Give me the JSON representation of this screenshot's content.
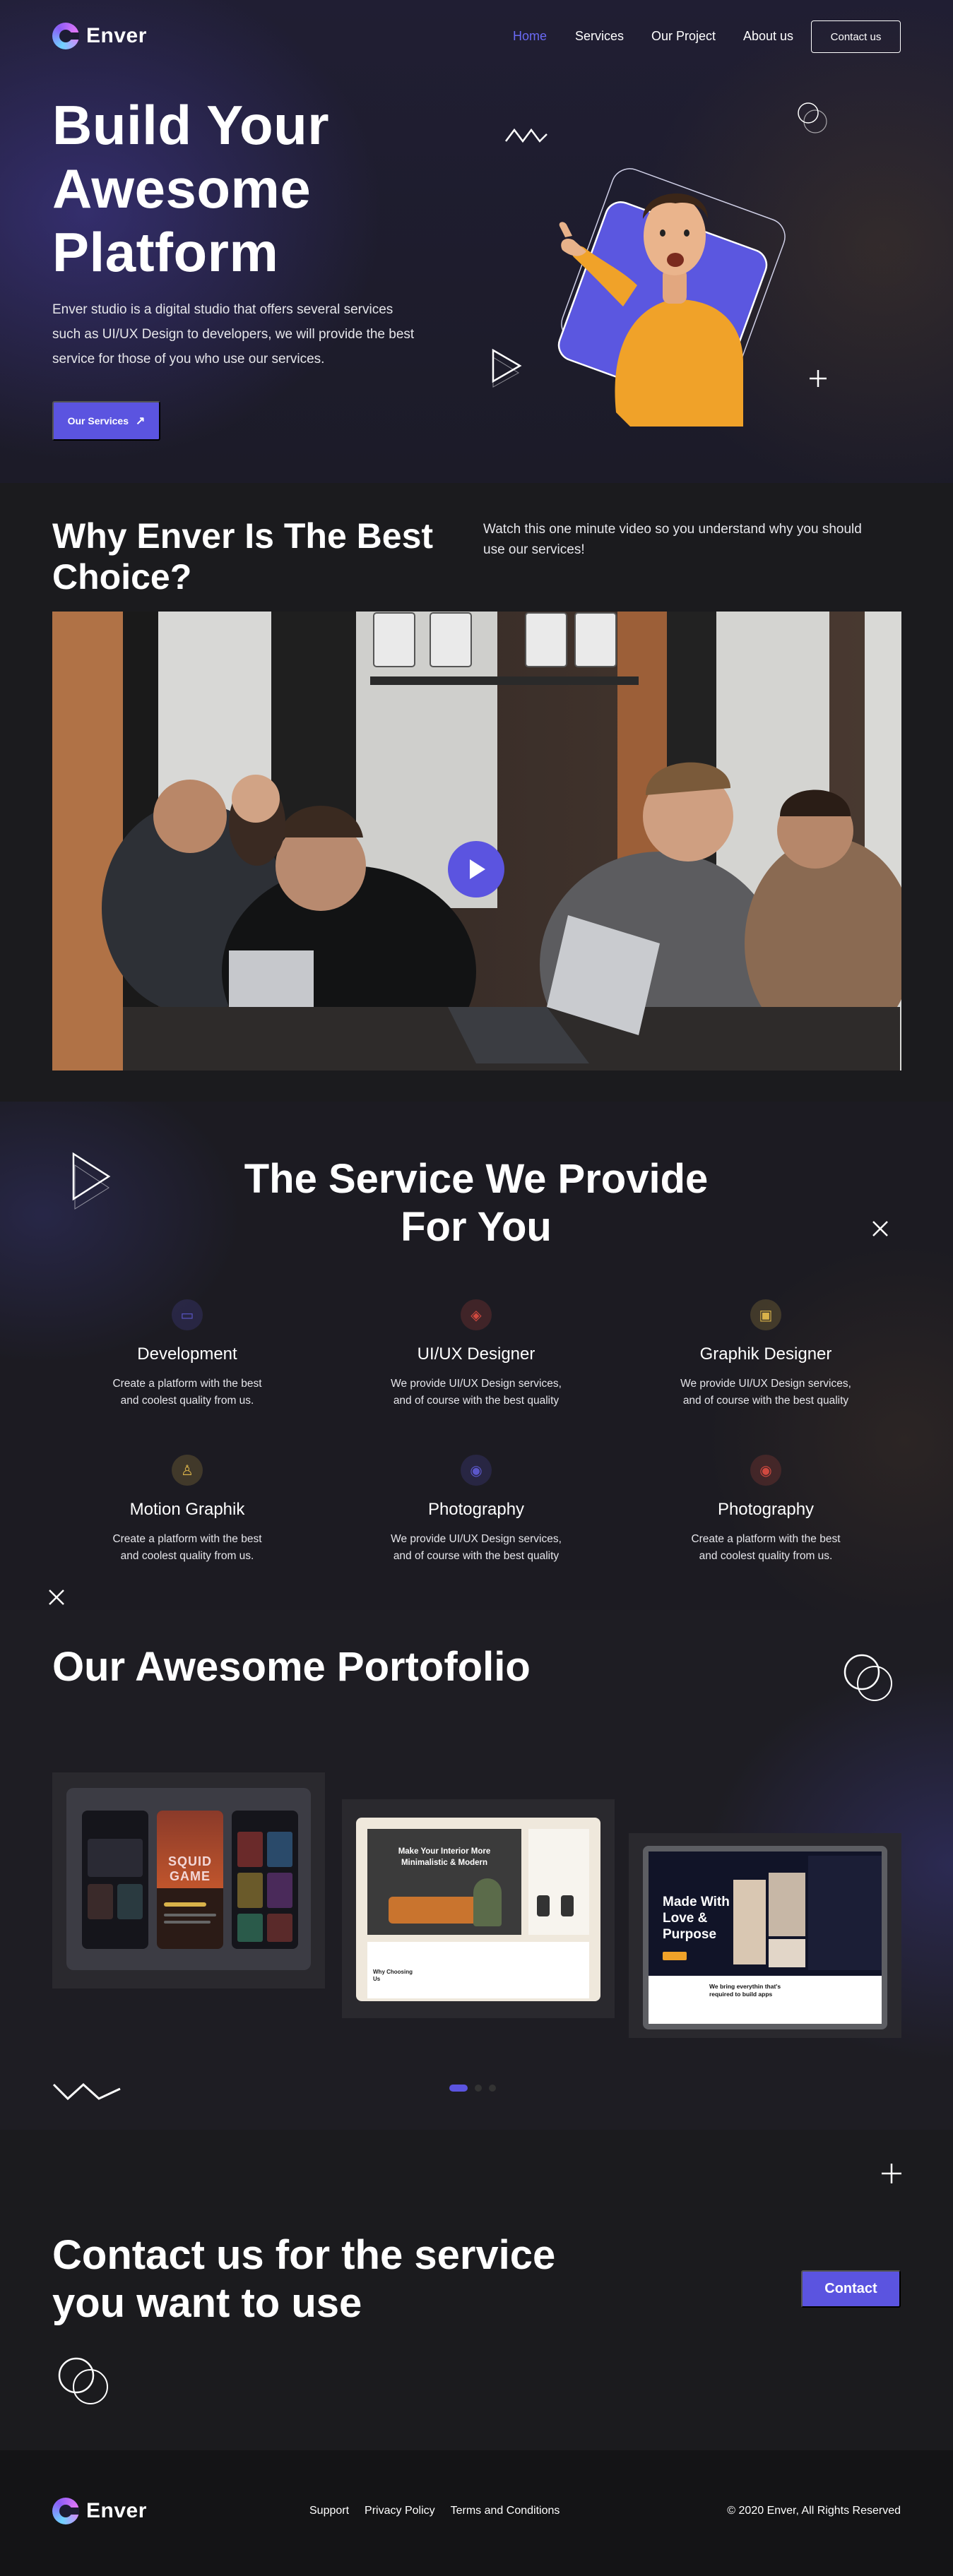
{
  "brand": {
    "name": "Enver"
  },
  "nav": {
    "items": [
      {
        "label": "Home"
      },
      {
        "label": "Services"
      },
      {
        "label": "Our Project"
      },
      {
        "label": "About us"
      }
    ],
    "contact_label": "Contact us"
  },
  "hero": {
    "title_lines": [
      "Build Your",
      "Awesome",
      "Platform"
    ],
    "description_lines": [
      "Enver studio is a digital studio that offers several services",
      "such as UI/UX Design to developers, we will provide the best",
      "service for those of you who use our services."
    ],
    "cta_label": "Our Services"
  },
  "why": {
    "title_lines": [
      "Why Enver Is The Best",
      "Choice?"
    ],
    "subtitle_lines": [
      "Watch this one minute video so you understand why you should",
      "use our services!"
    ]
  },
  "services": {
    "title_lines": [
      "The Service We Provide",
      "For You"
    ],
    "items": [
      {
        "name": "Development",
        "desc": [
          "Create a platform with the best",
          "and coolest quality from us."
        ],
        "icon": "code-window-icon",
        "color": "#5b57c9"
      },
      {
        "name": "UI/UX Designer",
        "desc": [
          "We provide UI/UX Design services,",
          "and of course with the best quality"
        ],
        "icon": "layers-icon",
        "color": "#d0493f"
      },
      {
        "name": "Graphik Designer",
        "desc": [
          "We provide UI/UX Design services,",
          "and of course with the best quality"
        ],
        "icon": "image-icon",
        "color": "#d8b24a"
      },
      {
        "name": "Motion Graphik",
        "desc": [
          "Create a platform with the best",
          "and coolest quality from us."
        ],
        "icon": "motion-icon",
        "color": "#d8b24a"
      },
      {
        "name": "Photography",
        "desc": [
          "We provide UI/UX Design services,",
          "and of course with the best quality"
        ],
        "icon": "camera-icon",
        "color": "#5b57c9"
      },
      {
        "name": "Photography",
        "desc": [
          "Create a platform with the best",
          "and coolest quality from us."
        ],
        "icon": "camera-icon",
        "color": "#d0493f"
      }
    ]
  },
  "portfolio": {
    "title": "Our Awesome Portofolio",
    "items": [
      {
        "title": "SQUID GAME"
      },
      {
        "title_lines": [
          "Make Your Interior More",
          "Minimalistic & Modern"
        ],
        "side_label": "Why Choosing Us"
      },
      {
        "title_lines": [
          "Made With",
          "Love &",
          "Purpose"
        ],
        "bottom_label": "We bring everythin that's required to build apps"
      }
    ]
  },
  "contact": {
    "title_lines": [
      "Contact us for the service",
      "you want to use"
    ],
    "button_label": "Contact"
  },
  "footer": {
    "links": [
      {
        "label": "Support"
      },
      {
        "label": "Privacy Policy"
      },
      {
        "label": "Terms and Conditions"
      }
    ],
    "copyright": "© 2020 Enver, All Rights Reserved"
  }
}
